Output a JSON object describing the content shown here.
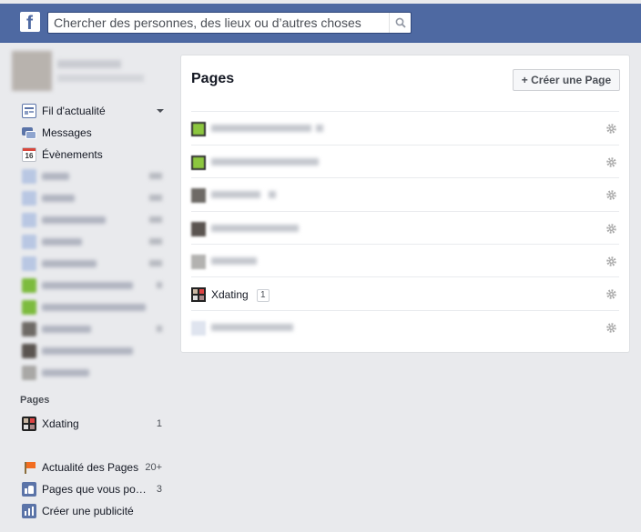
{
  "search": {
    "placeholder": "Chercher des personnes, des lieux ou d’autres choses"
  },
  "sidebar": {
    "favorites": [
      {
        "label": "Fil d'actualité",
        "icon": "news-feed-icon"
      },
      {
        "label": "Messages",
        "icon": "messages-icon"
      },
      {
        "label": "Évènements",
        "icon": "calendar-icon",
        "icon_text": "16"
      }
    ],
    "pages_title": "Pages",
    "pages": [
      {
        "label": "Xdating",
        "count": "1"
      }
    ],
    "extras": [
      {
        "label": "Actualité des Pages",
        "count": "20+",
        "icon": "flag-icon"
      },
      {
        "label": "Pages que vous po…",
        "count": "3",
        "icon": "thumbs-up-icon"
      },
      {
        "label": "Créer une publicité",
        "count": "",
        "icon": "bar-chart-icon"
      }
    ]
  },
  "main": {
    "title": "Pages",
    "create_button": "+ Créer une Page",
    "rows": [
      {
        "name": "Xdating",
        "badge": "1"
      }
    ]
  },
  "colors": {
    "topbar": "#4e69a2",
    "background": "#e9eaed",
    "text": "#141823"
  }
}
